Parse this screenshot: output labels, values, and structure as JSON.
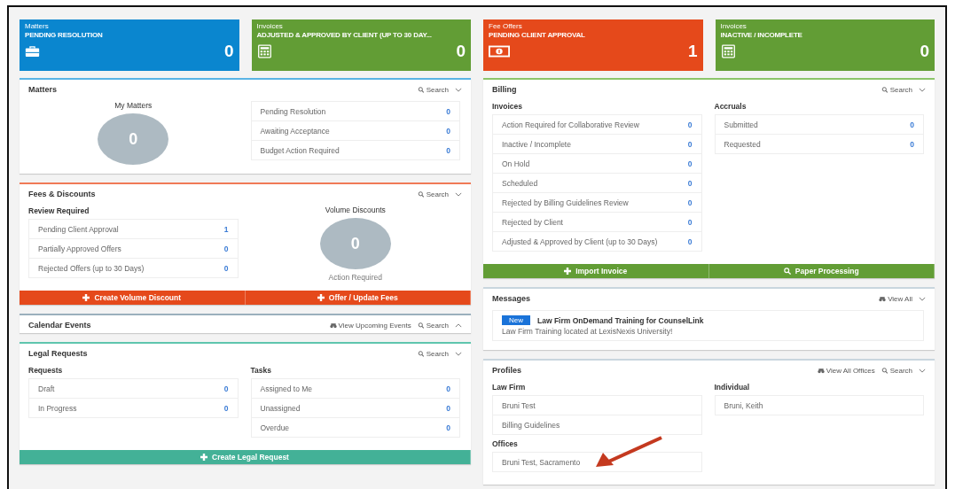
{
  "tiles": [
    {
      "category": "Matters",
      "label": "PENDING RESOLUTION",
      "count": "0",
      "color": "#0a86cf",
      "kind": "briefcase"
    },
    {
      "category": "Invoices",
      "label": "ADJUSTED & APPROVED BY CLIENT (UP TO 30 DAY...",
      "count": "0",
      "color": "#629d35",
      "kind": "calculator"
    },
    {
      "category": "Fee Offers",
      "label": "PENDING CLIENT APPROVAL",
      "count": "1",
      "color": "#e5491b",
      "kind": "money"
    },
    {
      "category": "Invoices",
      "label": "INACTIVE / INCOMPLETE",
      "count": "0",
      "color": "#629d35",
      "kind": "calculator"
    }
  ],
  "columns": [
    [
      {
        "title": "Matters",
        "color": "#5ab4e5",
        "expanded": true,
        "actions": [
          {
            "kind": "search",
            "label": "Search"
          }
        ],
        "blocks": [
          [
            {
              "kind": "stat",
              "heading": "My Matters",
              "value": "0"
            }
          ],
          [
            {
              "kind": "list",
              "items": [
                {
                  "label": "Pending Resolution",
                  "count": "0"
                },
                {
                  "label": "Awaiting Acceptance",
                  "count": "0"
                },
                {
                  "label": "Budget Action Required",
                  "count": "0"
                }
              ]
            }
          ]
        ]
      },
      {
        "title": "Fees & Discounts",
        "color": "#f07a57",
        "expanded": true,
        "actions": [
          {
            "kind": "search",
            "label": "Search"
          }
        ],
        "blocks": [
          [
            {
              "kind": "list",
              "heading": "Review Required",
              "items": [
                {
                  "label": "Pending Client Approval",
                  "count": "1"
                },
                {
                  "label": "Partially Approved Offers",
                  "count": "0"
                },
                {
                  "label": "Rejected Offers (up to 30 Days)",
                  "count": "0"
                }
              ]
            }
          ],
          [
            {
              "kind": "stat",
              "heading": "Volume Discounts",
              "value": "0",
              "caption": "Action Required"
            }
          ]
        ],
        "buttons": [
          {
            "label": "Create Volume Discount",
            "kind": "plus",
            "color": "#e5491b"
          },
          {
            "label": "Offer / Update Fees",
            "kind": "plus",
            "color": "#e5491b"
          }
        ]
      },
      {
        "title": "Calendar Events",
        "color": "#9ab0bd",
        "expanded": false,
        "actions": [
          {
            "kind": "view",
            "label": "View Upcoming Events"
          },
          {
            "kind": "search",
            "label": "Search"
          }
        ]
      },
      {
        "title": "Legal Requests",
        "color": "#5fc5ae",
        "expanded": true,
        "actions": [
          {
            "kind": "search",
            "label": "Search"
          }
        ],
        "blocks": [
          [
            {
              "kind": "list",
              "heading": "Requests",
              "items": [
                {
                  "label": "Draft",
                  "count": "0"
                },
                {
                  "label": "In Progress",
                  "count": "0"
                }
              ]
            }
          ],
          [
            {
              "kind": "list",
              "heading": "Tasks",
              "items": [
                {
                  "label": "Assigned to Me",
                  "count": "0"
                },
                {
                  "label": "Unassigned",
                  "count": "0"
                },
                {
                  "label": "Overdue",
                  "count": "0"
                }
              ]
            }
          ]
        ],
        "buttons": [
          {
            "label": "Create Legal Request",
            "kind": "plus",
            "color": "#43b197"
          }
        ]
      }
    ],
    [
      {
        "title": "Billing",
        "color": "#8cc56a",
        "expanded": true,
        "actions": [
          {
            "kind": "search",
            "label": "Search"
          }
        ],
        "blocks": [
          [
            {
              "kind": "list",
              "heading": "Invoices",
              "items": [
                {
                  "label": "Action Required for Collaborative Review",
                  "count": "0"
                },
                {
                  "label": "Inactive / Incomplete",
                  "count": "0"
                },
                {
                  "label": "On Hold",
                  "count": "0"
                },
                {
                  "label": "Scheduled",
                  "count": "0"
                },
                {
                  "label": "Rejected by Billing Guidelines Review",
                  "count": "0"
                },
                {
                  "label": "Rejected by Client",
                  "count": "0"
                },
                {
                  "label": "Adjusted & Approved by Client (up to 30 Days)",
                  "count": "0"
                }
              ]
            }
          ],
          [
            {
              "kind": "list",
              "heading": "Accruals",
              "items": [
                {
                  "label": "Submitted",
                  "count": "0"
                },
                {
                  "label": "Requested",
                  "count": "0"
                }
              ]
            }
          ]
        ],
        "buttons": [
          {
            "label": "Import Invoice",
            "kind": "plus",
            "color": "#629d35"
          },
          {
            "label": "Paper Processing",
            "kind": "search",
            "color": "#629d35"
          }
        ]
      },
      {
        "title": "Messages",
        "color": "#c9d6de",
        "expanded": true,
        "actions": [
          {
            "kind": "view",
            "label": "View All"
          }
        ],
        "blocks": [
          [
            {
              "kind": "message",
              "badge": "New",
              "title": "Law Firm OnDemand Training for CounselLink",
              "body": "Law Firm Training located at LexisNexis University!"
            }
          ]
        ]
      },
      {
        "title": "Profiles",
        "color": "#c9d6de",
        "expanded": true,
        "arrow_annotation": true,
        "actions": [
          {
            "kind": "view",
            "label": "View All Offices"
          },
          {
            "kind": "search",
            "label": "Search"
          }
        ],
        "blocks": [
          [
            {
              "kind": "list",
              "heading": "Law Firm",
              "items": [
                {
                  "label": "Bruni Test"
                },
                {
                  "label": "Billing Guidelines"
                }
              ]
            },
            {
              "kind": "list",
              "heading": "Offices",
              "items": [
                {
                  "label": "Bruni Test, Sacramento"
                }
              ]
            }
          ],
          [
            {
              "kind": "list",
              "heading": "Individual",
              "items": [
                {
                  "label": "Bruni, Keith"
                }
              ]
            }
          ]
        ]
      }
    ]
  ]
}
